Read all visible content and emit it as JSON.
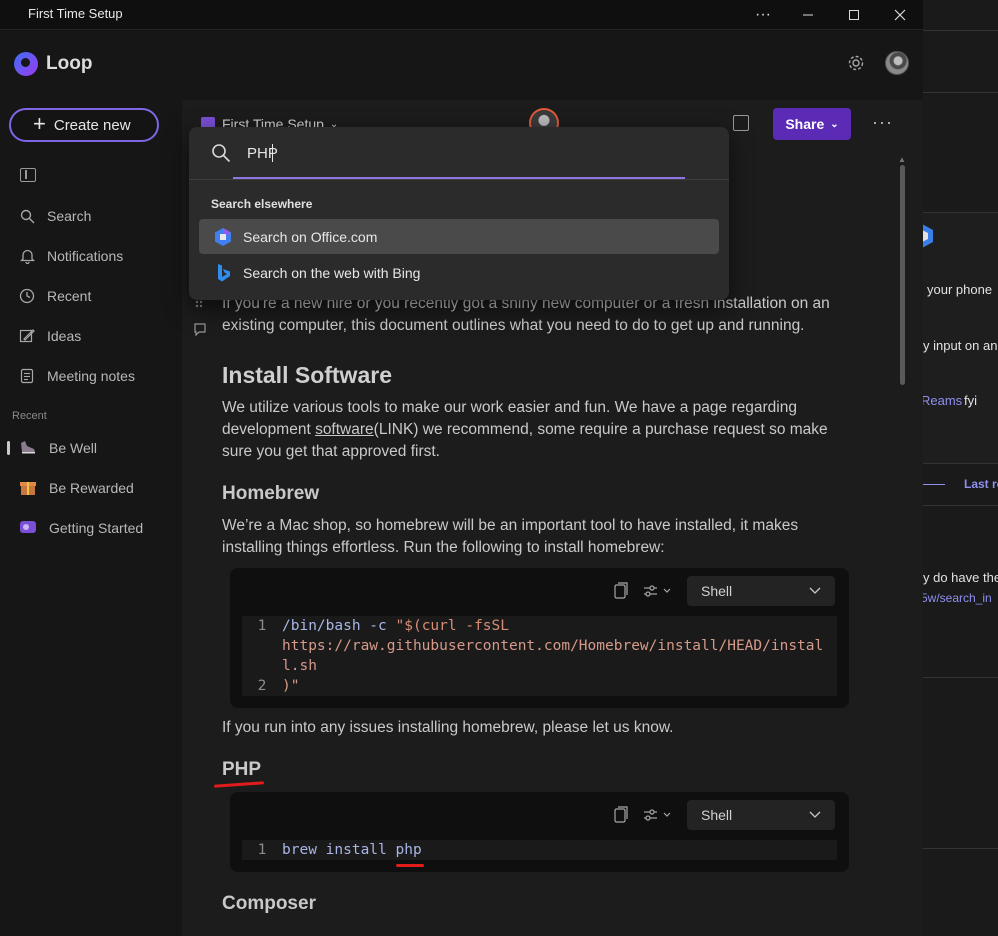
{
  "window": {
    "title": "First Time Setup",
    "more": "···",
    "minimize": "—",
    "maximize": "▢",
    "close": "✕"
  },
  "app": {
    "name": "Loop",
    "create_new_label": "Create new"
  },
  "sidebar": {
    "items": [
      {
        "label": "Search",
        "icon": "search-icon"
      },
      {
        "label": "Notifications",
        "icon": "bell-icon"
      },
      {
        "label": "Recent",
        "icon": "clock-icon"
      },
      {
        "label": "Ideas",
        "icon": "pencil-icon"
      },
      {
        "label": "Meeting notes",
        "icon": "notes-icon"
      }
    ],
    "recent_label": "Recent",
    "recent_items": [
      {
        "label": "Be Well",
        "icon": "running-shoe-icon"
      },
      {
        "label": "Be Rewarded",
        "icon": "gift-icon"
      },
      {
        "label": "Getting Started",
        "icon": "loop-card-icon"
      }
    ]
  },
  "page_header": {
    "doc_title": "First Time Setup",
    "share_label": "Share",
    "more": "···"
  },
  "search": {
    "value": "PHP",
    "heading": "Search elsewhere",
    "options": [
      {
        "label": "Search on Office.com",
        "icon": "office-icon"
      },
      {
        "label": "Search on the web with Bing",
        "icon": "bing-icon"
      }
    ]
  },
  "doc": {
    "intro": "If you're a new hire or you recently got a shiny new computer or a fresh installation on an existing computer, this document outlines what you need to do to get up and running.",
    "h_install": "Install Software",
    "p_install_1": "We utilize various tools to make our work easier and fun. We have a page regarding development ",
    "p_install_link": "software",
    "p_install_2": "(LINK) we recommend, some require a purchase request so make sure you get that approved first.",
    "h_homebrew": "Homebrew",
    "p_homebrew": "We’re a Mac shop, so homebrew will be an important tool to have installed, it makes installing things effortless. Run the following to install homebrew:",
    "code1": {
      "language": "Shell",
      "lines": [
        {
          "n": "1",
          "cmd": "/bin/bash",
          "flag": " -c ",
          "str1": "\"$(curl -fsSL",
          "str2": "https://raw.githubusercontent.com/Homebrew/install/HEAD/instal",
          "str3": "l.sh"
        },
        {
          "n": "2",
          "text": ")\""
        }
      ]
    },
    "p_issues": "If you run into any issues installing homebrew, please let us know.",
    "h_php": "PHP",
    "code2": {
      "language": "Shell",
      "lines": [
        {
          "n": "1",
          "text": "brew install php"
        }
      ]
    },
    "h_composer": "Composer"
  },
  "background_window": {
    "texts": [
      "your phone",
      "y input on an",
      "Reams",
      "fyi",
      "Last re",
      "y do have the",
      "5w/search_in"
    ]
  },
  "colors": {
    "accent": "#8065e6",
    "share": "#5b2bb6",
    "annotation_red": "#e21b1b"
  }
}
